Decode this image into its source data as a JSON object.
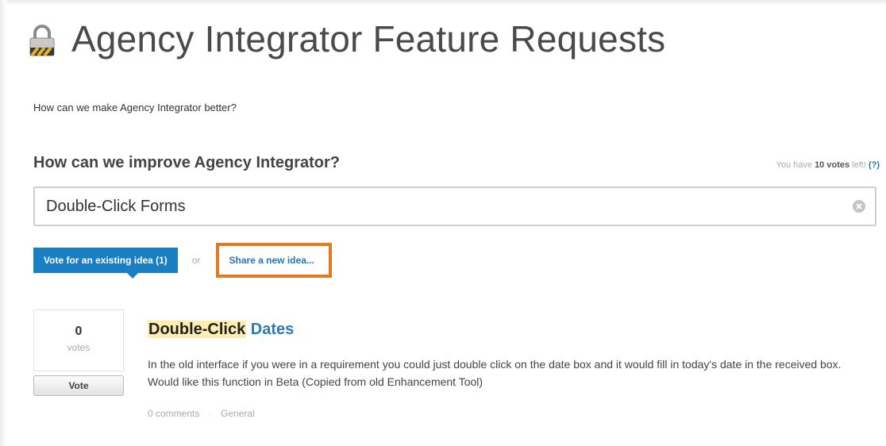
{
  "header": {
    "title": "Agency Integrator Feature Requests"
  },
  "intro": "How can we make Agency Integrator better?",
  "prompt": {
    "heading": "How can we improve Agency Integrator?",
    "votes_left_prefix": "You have",
    "votes_left_count": "10 votes",
    "votes_left_suffix": "left!",
    "help_label": "(?)"
  },
  "search": {
    "value": "Double-Click Forms"
  },
  "actions": {
    "vote_existing_label": "Vote for an existing idea (1)",
    "or_label": "or",
    "share_label": "Share a new idea..."
  },
  "idea": {
    "vote_count": "0",
    "vote_unit": "votes",
    "vote_button": "Vote",
    "title_highlight": "Double-Click",
    "title_rest": " Dates",
    "description": "In the old interface if you were in a requirement you could just double click on the date box and it would fill in today's date in the received box. Would like this function in Beta (Copied from old Enhancement Tool)",
    "comments": "0 comments",
    "category": "General"
  },
  "colors": {
    "accent_blue": "#1a7fc1",
    "link_blue": "#2a74b8",
    "highlight_box": "#e07b22",
    "search_highlight": "#fbeeb0"
  }
}
